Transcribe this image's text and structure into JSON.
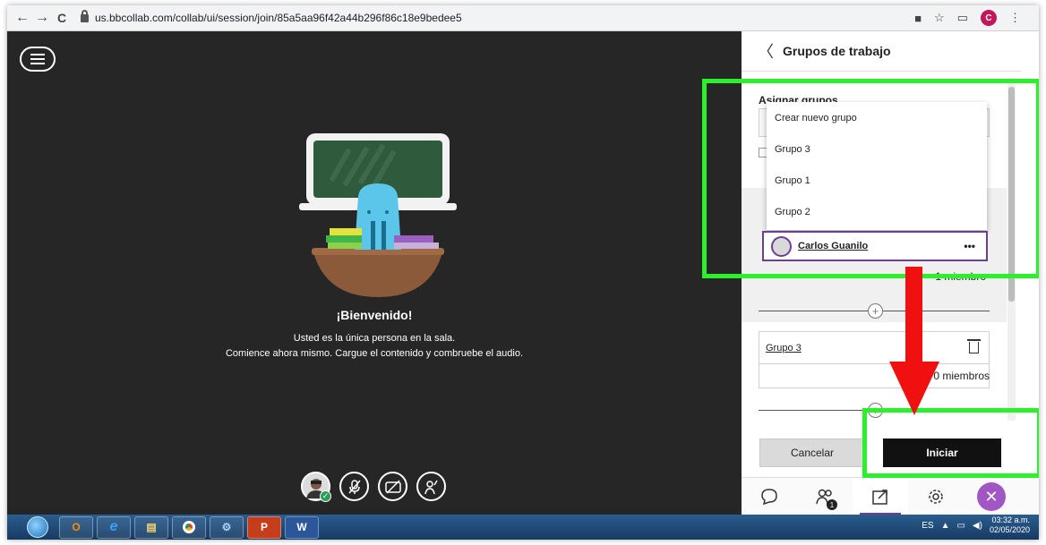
{
  "browser": {
    "url": "us.bbcollab.com/collab/ui/session/join/85a5aa96f42a44b296f86c18e9bedee5",
    "profile_initial": "C",
    "back_glyph": "←",
    "forward_glyph": "→",
    "reload_glyph": "C"
  },
  "stage": {
    "welcome_title": "¡Bienvenido!",
    "welcome_line1": "Usted es la única persona en la sala.",
    "welcome_line2": "Comience ahora mismo. Cargue el contenido y combruebe el audio."
  },
  "panel": {
    "back_glyph": "〈",
    "title": "Grupos de trabajo",
    "assign_label": "Asignar grupos",
    "dropdown_options": [
      "Crear nuevo grupo",
      "Grupo 3",
      "Grupo 1",
      "Grupo 2"
    ],
    "member_name": "Carlos Guanilo",
    "member_more": "•••",
    "member_count": "1 miembro",
    "group_card": {
      "name": "Grupo 3",
      "count": "0 miembros"
    },
    "cancel_label": "Cancelar",
    "start_label": "Iniciar"
  },
  "taskbar": {
    "language": "ES",
    "time": "03:32 a.m.",
    "date": "02/05/2020"
  },
  "icons": {
    "menu": "hamburger-menu-icon",
    "mic": "microphone-muted-icon",
    "camera": "camera-off-icon",
    "hand": "raise-hand-icon",
    "chat": "chat-icon",
    "attendees": "attendees-icon",
    "share": "share-content-icon",
    "settings": "settings-icon",
    "close": "close-icon"
  },
  "colors": {
    "accent_purple": "#6d3f8f",
    "highlight_green": "#2cf02c",
    "arrow_red": "#f01010",
    "stage_bg": "#262626"
  }
}
